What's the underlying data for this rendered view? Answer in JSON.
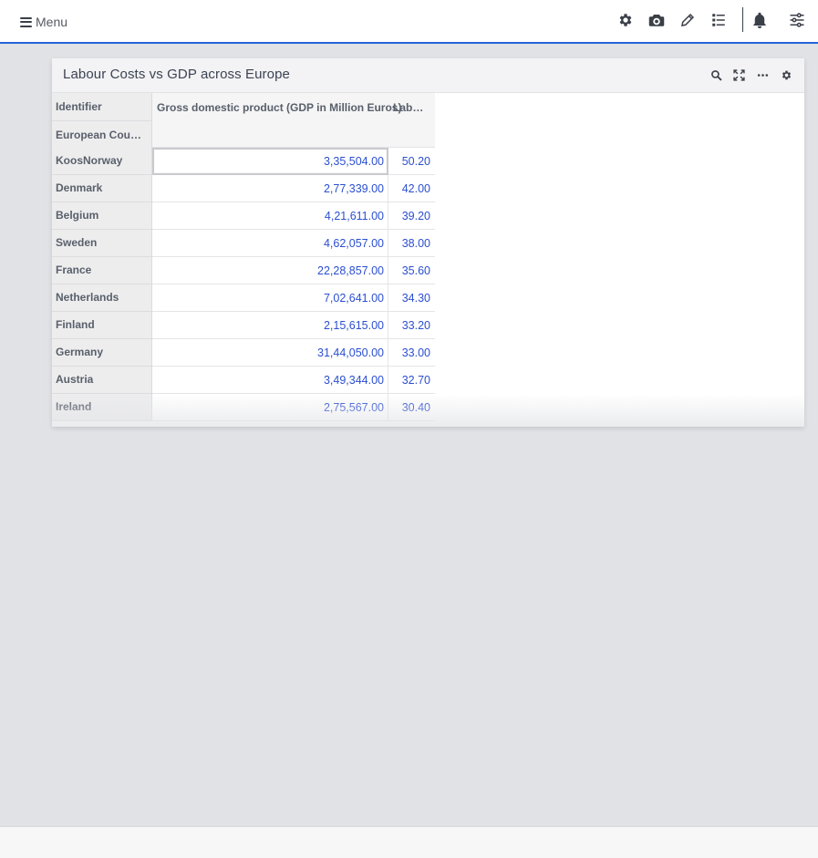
{
  "header": {
    "menu_label": "Menu",
    "icons": [
      "gear-icon",
      "camera-icon",
      "pencil-icon",
      "list-icon",
      "bell-icon",
      "sliders-icon"
    ]
  },
  "panel": {
    "title": "Labour Costs vs GDP across Europe",
    "icons": [
      "search-icon",
      "expand-icon",
      "more-icon",
      "settings-icon"
    ]
  },
  "grid": {
    "row_header_1": "Identifier",
    "row_header_2": "European Countri…",
    "columns": [
      "Gross domestic product (GDP in Million Euros)",
      "Labo…"
    ],
    "rows": [
      {
        "country": "KoosNorway",
        "gdp": "3,35,504.00",
        "labour": "50.20"
      },
      {
        "country": "Denmark",
        "gdp": "2,77,339.00",
        "labour": "42.00"
      },
      {
        "country": "Belgium",
        "gdp": "4,21,611.00",
        "labour": "39.20"
      },
      {
        "country": "Sweden",
        "gdp": "4,62,057.00",
        "labour": "38.00"
      },
      {
        "country": "France",
        "gdp": "22,28,857.00",
        "labour": "35.60"
      },
      {
        "country": "Netherlands",
        "gdp": "7,02,641.00",
        "labour": "34.30"
      },
      {
        "country": "Finland",
        "gdp": "2,15,615.00",
        "labour": "33.20"
      },
      {
        "country": "Germany",
        "gdp": "31,44,050.00",
        "labour": "33.00"
      },
      {
        "country": "Austria",
        "gdp": "3,49,344.00",
        "labour": "32.70"
      },
      {
        "country": "Ireland",
        "gdp": "2,75,567.00",
        "labour": "30.40"
      }
    ]
  },
  "colors": {
    "accent": "#2563d9",
    "value_text": "#2b4fd0",
    "background": "#e1e2e6"
  }
}
